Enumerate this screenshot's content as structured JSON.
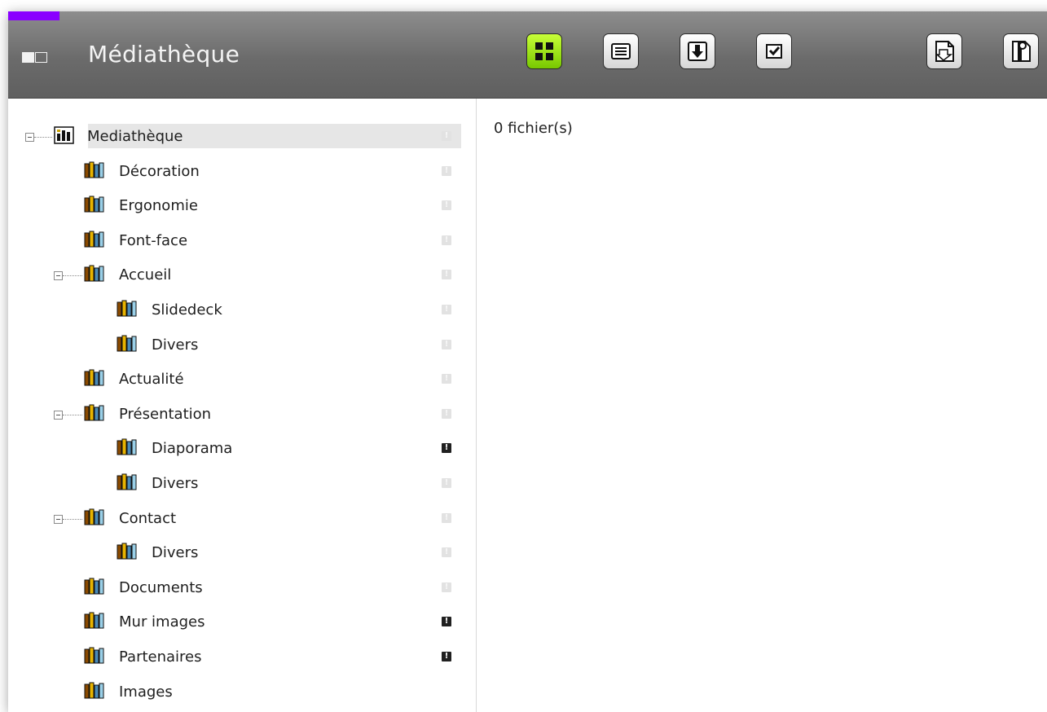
{
  "app": {
    "title": "Médiathèque"
  },
  "toolbar": {
    "buttons": [
      {
        "name": "grid-view",
        "icon": "grid-icon",
        "active": true
      },
      {
        "name": "list-view",
        "icon": "list-icon",
        "active": false
      },
      {
        "name": "sort-down",
        "icon": "arrow-down-icon",
        "active": false
      },
      {
        "name": "select",
        "icon": "checkbox-icon",
        "active": false
      },
      {
        "name": "upload",
        "icon": "upload-file-icon",
        "active": false
      },
      {
        "name": "zip",
        "icon": "zip-file-icon",
        "active": false
      }
    ]
  },
  "content": {
    "file_count": "0 fichier(s)"
  },
  "tree": {
    "root": {
      "label": "Mediathèque",
      "expanded": true,
      "flag": "light"
    },
    "items": [
      {
        "label": "Décoration",
        "level": 1,
        "flag": "light"
      },
      {
        "label": "Ergonomie",
        "level": 1,
        "flag": "light"
      },
      {
        "label": "Font-face",
        "level": 1,
        "flag": "light"
      },
      {
        "label": "Accueil",
        "level": 1,
        "expanded": true,
        "flag": "light"
      },
      {
        "label": "Slidedeck",
        "level": 2,
        "flag": "light"
      },
      {
        "label": "Divers",
        "level": 2,
        "flag": "light"
      },
      {
        "label": "Actualité",
        "level": 1,
        "flag": "light"
      },
      {
        "label": "Présentation",
        "level": 1,
        "expanded": true,
        "flag": "light"
      },
      {
        "label": "Diaporama",
        "level": 2,
        "flag": "dark"
      },
      {
        "label": "Divers",
        "level": 2,
        "flag": "light"
      },
      {
        "label": "Contact",
        "level": 1,
        "expanded": true,
        "flag": "light"
      },
      {
        "label": "Divers",
        "level": 2,
        "flag": "light"
      },
      {
        "label": "Documents",
        "level": 1,
        "flag": "light"
      },
      {
        "label": "Mur images",
        "level": 1,
        "flag": "dark"
      },
      {
        "label": "Partenaires",
        "level": 1,
        "flag": "dark"
      },
      {
        "label": "Images",
        "level": 1,
        "flag": "none"
      }
    ]
  },
  "colors": {
    "accent": "#8a00ff",
    "active_button": "#9be000",
    "header": "#777777"
  }
}
